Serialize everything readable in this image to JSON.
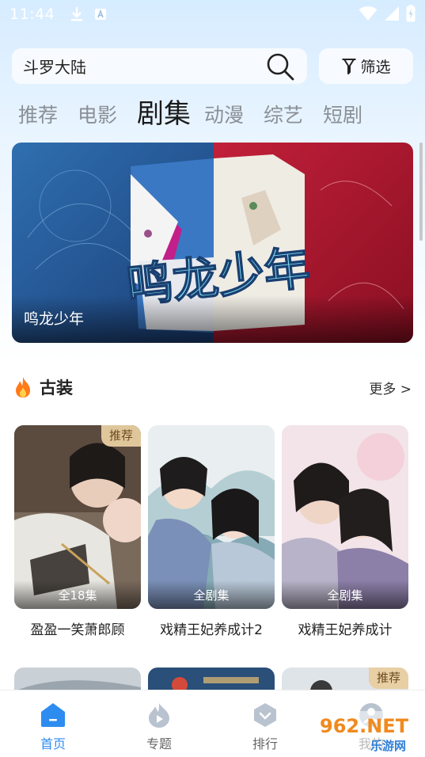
{
  "status_bar": {
    "time": "11:44"
  },
  "search": {
    "query": "斗罗大陆"
  },
  "filter": {
    "label": "筛选"
  },
  "tabs": [
    {
      "label": "推荐",
      "active": false
    },
    {
      "label": "电影",
      "active": false
    },
    {
      "label": "剧集",
      "active": true
    },
    {
      "label": "动漫",
      "active": false
    },
    {
      "label": "综艺",
      "active": false
    },
    {
      "label": "短剧",
      "active": false
    }
  ],
  "banner": {
    "caption": "鸣龙少年",
    "art_text": "鸣龙少年"
  },
  "section": {
    "title": "古装",
    "more": "更多 >"
  },
  "cards": [
    {
      "title": "盈盈一笑萧郎顾",
      "badge": "推荐",
      "episodes": "全18集"
    },
    {
      "title": "戏精王妃养成计2",
      "badge": "",
      "episodes": "全剧集"
    },
    {
      "title": "戏精王妃养成计",
      "badge": "",
      "episodes": "全剧集"
    }
  ],
  "row2": {
    "badge": "推荐"
  },
  "nav": [
    {
      "label": "首页",
      "icon": "home-icon",
      "active": true
    },
    {
      "label": "专题",
      "icon": "topic-icon",
      "active": false
    },
    {
      "label": "排行",
      "icon": "ranking-icon",
      "active": false
    },
    {
      "label": "我的",
      "icon": "profile-icon",
      "active": false
    }
  ],
  "watermark": {
    "text": "962.NET",
    "subtext": "乐游网"
  },
  "colors": {
    "accent": "#2d8cf0",
    "badge_bg": "#e8cea0"
  }
}
